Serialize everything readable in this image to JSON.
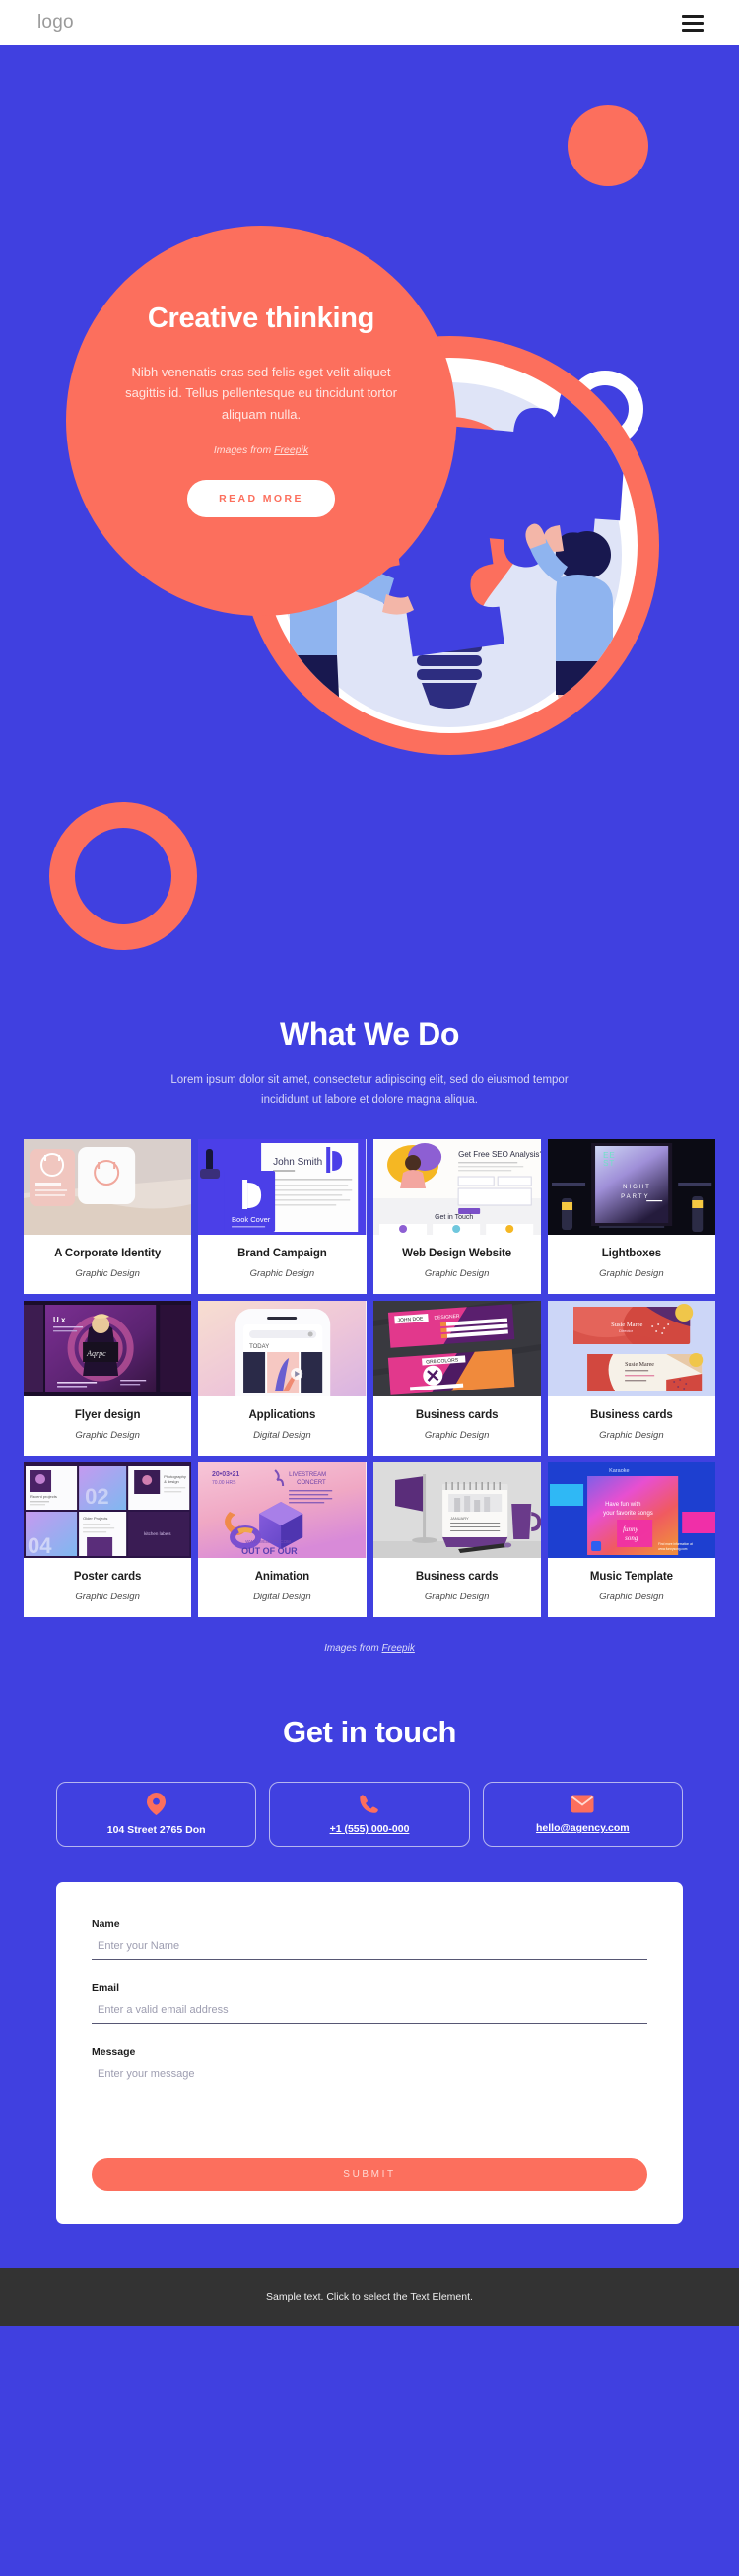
{
  "header": {
    "logo": "logo",
    "menu_icon": "hamburger-menu-icon"
  },
  "hero": {
    "title": "Creative thinking",
    "paragraph": "Nibh venenatis cras sed felis eget velit aliquet sagittis id. Tellus pellentesque eu tincidunt tortor aliquam nulla.",
    "credit_prefix": "Images from ",
    "credit_link": "Freepik",
    "button": "READ MORE"
  },
  "whatwedo": {
    "title": "What We Do",
    "subtitle": "Lorem ipsum dolor sit amet, consectetur adipiscing elit, sed do eiusmod tempor incididunt ut labore et dolore magna aliqua.",
    "credit_prefix": "Images from ",
    "credit_link": "Freepik",
    "items": [
      {
        "title": "A Corporate Identity",
        "category": "Graphic Design",
        "thumb": "branding-stationery"
      },
      {
        "title": "Brand Campaign",
        "category": "Graphic Design",
        "thumb": "book-cover-letterhead"
      },
      {
        "title": "Web Design Website",
        "category": "Graphic Design",
        "thumb": "seo-landing-page"
      },
      {
        "title": "Lightboxes",
        "category": "Graphic Design",
        "thumb": "night-party-billboard"
      },
      {
        "title": "Flyer design",
        "category": "Graphic Design",
        "thumb": "ux-event-poster"
      },
      {
        "title": "Applications",
        "category": "Digital Design",
        "thumb": "mobile-app-mockup"
      },
      {
        "title": "Business cards",
        "category": "Graphic Design",
        "thumb": "pink-purple-cards"
      },
      {
        "title": "Business cards",
        "category": "Graphic Design",
        "thumb": "abstract-name-cards"
      },
      {
        "title": "Poster cards",
        "category": "Graphic Design",
        "thumb": "portfolio-layout"
      },
      {
        "title": "Animation",
        "category": "Digital Design",
        "thumb": "livestream-concert-3d"
      },
      {
        "title": "Business cards",
        "category": "Graphic Design",
        "thumb": "desk-calendar-mug"
      },
      {
        "title": "Music Template",
        "category": "Graphic Design",
        "thumb": "karaoke-gradient"
      }
    ]
  },
  "contact": {
    "title": "Get in touch",
    "cards": [
      {
        "icon": "map-pin-icon",
        "label": "104 Street 2765 Don",
        "underlined": false
      },
      {
        "icon": "phone-icon",
        "label": "+1 (555) 000-000",
        "underlined": true
      },
      {
        "icon": "envelope-icon",
        "label": "hello@agency.com",
        "underlined": true
      }
    ],
    "form": {
      "name_label": "Name",
      "name_placeholder": "Enter your Name",
      "email_label": "Email",
      "email_placeholder": "Enter a valid email address",
      "message_label": "Message",
      "message_placeholder": "Enter your message",
      "submit": "SUBMIT"
    }
  },
  "footer": {
    "text": "Sample text. Click to select the Text Element."
  },
  "colors": {
    "blue": "#4040e0",
    "coral": "#fc6f5d",
    "white": "#ffffff",
    "footer_dark": "#333333"
  }
}
